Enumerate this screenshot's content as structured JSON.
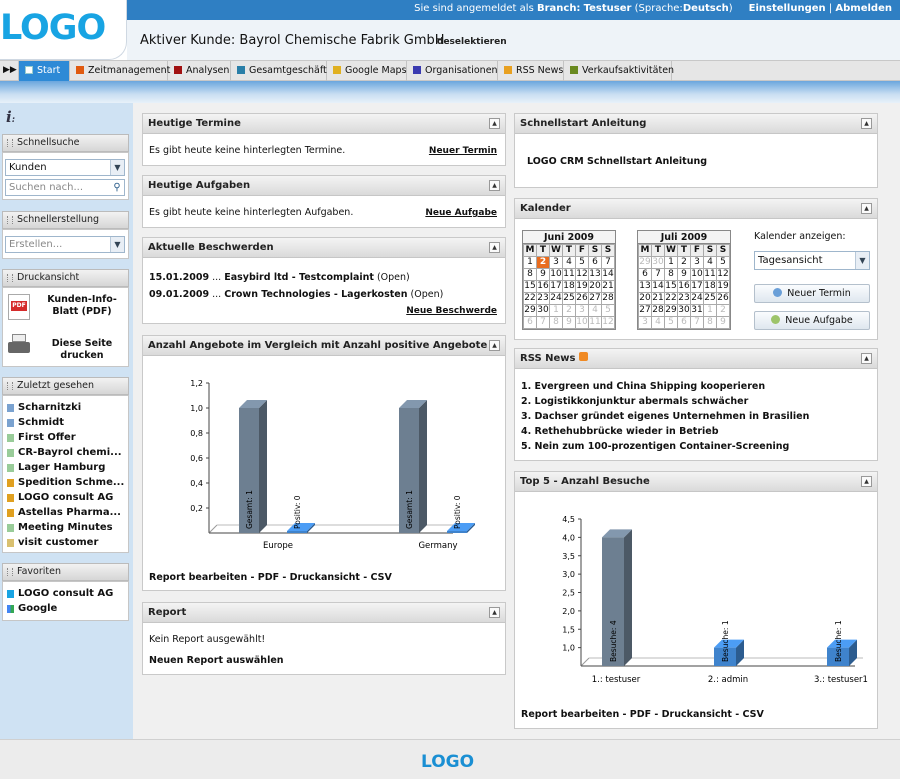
{
  "topbar": {
    "prefix": "Sie sind angemeldet als",
    "branch_label": "Branch:",
    "user": "Testuser",
    "lang_label": "(Sprache:",
    "lang": "Deutsch",
    "lang_close": ")",
    "settings": "Einstellungen",
    "separator": "|",
    "logout": "Abmelden"
  },
  "logo": {
    "text": "LOGO",
    "color": "#18a4e3"
  },
  "header": {
    "customer": "Aktiver Kunde: Bayrol Chemische Fabrik GmbH",
    "deselect": "deselektieren"
  },
  "tabs": [
    {
      "label": "Start",
      "color": "#ffffff"
    },
    {
      "label": "Zeitmanagement",
      "color": "#e05a10"
    },
    {
      "label": "Analysen",
      "color": "#a01010"
    },
    {
      "label": "Gesamtgeschäft",
      "color": "#2a7fa8"
    },
    {
      "label": "Google Maps",
      "color": "#e0b020"
    },
    {
      "label": "Organisationen",
      "color": "#3a3ab0"
    },
    {
      "label": "RSS News",
      "color": "#e8a020"
    },
    {
      "label": "Verkaufsaktivitäten",
      "color": "#6a8a20"
    }
  ],
  "sidebar": {
    "info_icon": "info-icon",
    "quicksearch": {
      "title": "Schnellsuche",
      "select": "Kunden",
      "placeholder": "Suchen nach..."
    },
    "quickcreate": {
      "title": "Schnellerstellung",
      "select": "Erstellen..."
    },
    "print": {
      "title": "Druckansicht",
      "pdf": "Kunden-Info-Blatt (PDF)",
      "print": "Diese Seite drucken"
    },
    "recent": {
      "title": "Zuletzt gesehen",
      "items": [
        "Scharnitzki",
        "Schmidt",
        "First Offer",
        "CR-Bayrol chemi...",
        "Lager Hamburg",
        "Spedition Schme...",
        "LOGO consult AG",
        "Astellas Pharma...",
        "Meeting Minutes",
        "visit customer"
      ]
    },
    "favorites": {
      "title": "Favoriten",
      "items": [
        "LOGO consult AG",
        "Google"
      ]
    }
  },
  "panels": {
    "termine": {
      "title": "Heutige Termine",
      "text": "Es gibt heute keine hinterlegten Termine.",
      "link": "Neuer Termin"
    },
    "aufgaben": {
      "title": "Heutige Aufgaben",
      "text": "Es gibt heute keine hinterlegten Aufgaben.",
      "link": "Neue Aufgabe"
    },
    "beschwerden": {
      "title": "Aktuelle Beschwerden",
      "items": [
        {
          "date": "15.01.2009",
          "sep": "...",
          "text": "Easybird ltd - Testcomplaint",
          "status": "(Open)"
        },
        {
          "date": "09.01.2009",
          "sep": "...",
          "text": "Crown Technologies - Lagerkosten",
          "status": "(Open)"
        }
      ],
      "link": "Neue Beschwerde"
    },
    "angebote": {
      "title": "Anzahl Angebote im Vergleich mit Anzahl positive Angebote",
      "footer": "Report bearbeiten - PDF - Druckansicht - CSV"
    },
    "report": {
      "title": "Report",
      "text": "Kein Report ausgewählt!",
      "link": "Neuen Report auswählen"
    },
    "schnellstart": {
      "title": "Schnellstart Anleitung",
      "link": "LOGO CRM Schnellstart Anleitung"
    },
    "kalender": {
      "title": "Kalender",
      "show_label": "Kalender anzeigen:",
      "view": "Tagesansicht",
      "new_appointment": "Neuer Termin",
      "new_task": "Neue Aufgabe",
      "weekdays": [
        "M",
        "T",
        "W",
        "T",
        "F",
        "S",
        "S"
      ],
      "months": [
        {
          "title": "Juni 2009",
          "weeks": [
            [
              "1",
              "2",
              "3",
              "4",
              "5",
              "6",
              "7"
            ],
            [
              "8",
              "9",
              "10",
              "11",
              "12",
              "13",
              "14"
            ],
            [
              "15",
              "16",
              "17",
              "18",
              "19",
              "20",
              "21"
            ],
            [
              "22",
              "23",
              "24",
              "25",
              "26",
              "27",
              "28"
            ],
            [
              "29",
              "30",
              "1",
              "2",
              "3",
              "4",
              "5"
            ],
            [
              "6",
              "7",
              "8",
              "9",
              "10",
              "11",
              "12"
            ]
          ],
          "grey": [
            [
              4,
              2
            ],
            [
              4,
              3
            ],
            [
              4,
              4
            ],
            [
              4,
              5
            ],
            [
              4,
              6
            ],
            [
              5,
              0
            ],
            [
              5,
              1
            ],
            [
              5,
              2
            ],
            [
              5,
              3
            ],
            [
              5,
              4
            ],
            [
              5,
              5
            ],
            [
              5,
              6
            ]
          ],
          "today": [
            0,
            1
          ]
        },
        {
          "title": "Juli 2009",
          "weeks": [
            [
              "29",
              "30",
              "1",
              "2",
              "3",
              "4",
              "5"
            ],
            [
              "6",
              "7",
              "8",
              "9",
              "10",
              "11",
              "12"
            ],
            [
              "13",
              "14",
              "15",
              "16",
              "17",
              "18",
              "19"
            ],
            [
              "20",
              "21",
              "22",
              "23",
              "24",
              "25",
              "26"
            ],
            [
              "27",
              "28",
              "29",
              "30",
              "31",
              "1",
              "2"
            ],
            [
              "3",
              "4",
              "5",
              "6",
              "7",
              "8",
              "9"
            ]
          ],
          "grey": [
            [
              0,
              0
            ],
            [
              0,
              1
            ],
            [
              4,
              5
            ],
            [
              4,
              6
            ],
            [
              5,
              0
            ],
            [
              5,
              1
            ],
            [
              5,
              2
            ],
            [
              5,
              3
            ],
            [
              5,
              4
            ],
            [
              5,
              5
            ],
            [
              5,
              6
            ]
          ],
          "today": null
        }
      ]
    },
    "rss": {
      "title": "RSS News",
      "items": [
        "1. Evergreen und China Shipping kooperieren",
        "2. Logistikkonjunktur abermals schwächer",
        "3. Dachser gründet eigenes Unternehmen in Brasilien",
        "4. Rethehubbrücke wieder in Betrieb",
        "5. Nein zum 100-prozentigen Container-Screening"
      ]
    },
    "top5": {
      "title": "Top 5 - Anzahl Besuche",
      "footer": "Report bearbeiten - PDF - Druckansicht - CSV"
    }
  },
  "chart_data": [
    {
      "type": "bar",
      "categories": [
        "Europe",
        "Germany"
      ],
      "series": [
        {
          "name": "Gesamt",
          "values": [
            1,
            1
          ],
          "color": "#6d7f91",
          "label_prefix": "Gesamt: "
        },
        {
          "name": "Positiv",
          "values": [
            0,
            0
          ],
          "color": "#3f83cc",
          "label_prefix": "Positiv: "
        }
      ],
      "yticks": [
        "0,2",
        "0,4",
        "0,6",
        "0,8",
        "1,0",
        "1,2"
      ],
      "ylim": [
        0,
        1.2
      ]
    },
    {
      "type": "bar",
      "categories": [
        "1.: testuser",
        "2.: admin",
        "3.: testuser1"
      ],
      "series": [
        {
          "name": "Besuche",
          "values": [
            4,
            1,
            1
          ],
          "colors": [
            "#6d7f91",
            "#3f83cc",
            "#3f83cc"
          ],
          "label_prefix": "Besuche: "
        }
      ],
      "yticks": [
        "1,0",
        "1,5",
        "2,0",
        "2,5",
        "3,0",
        "3,5",
        "4,0",
        "4,5"
      ],
      "ylim": [
        0.5,
        4.5
      ]
    }
  ],
  "footer": {
    "logo": "LOGO"
  }
}
